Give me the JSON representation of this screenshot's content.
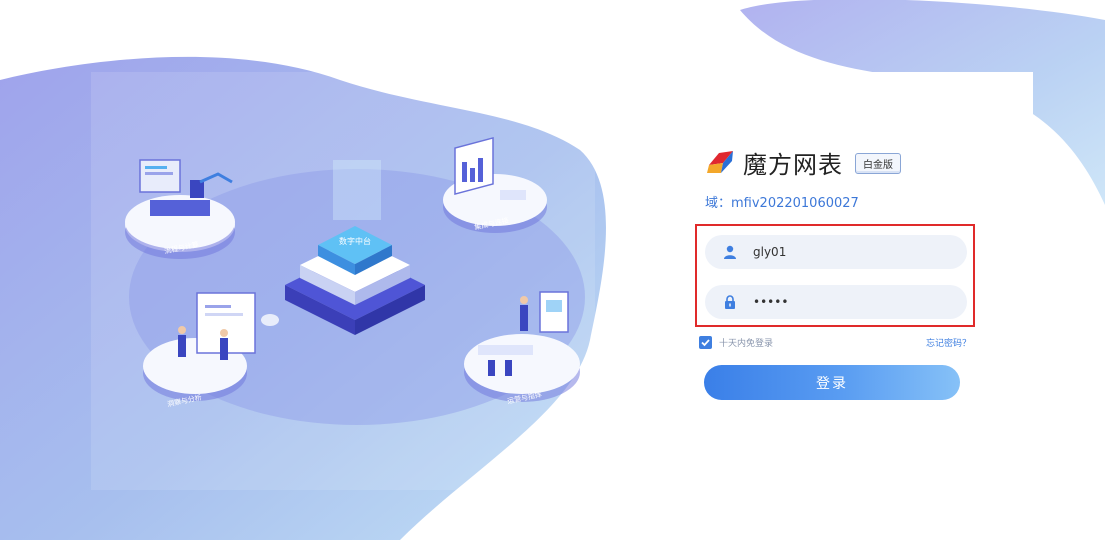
{
  "brand": {
    "name": "魔方网表",
    "edition": "白金版"
  },
  "domain": {
    "text": "域：mfiv202201060027"
  },
  "login_form": {
    "username_value": "gly01",
    "password_value": "•••••",
    "remember_label": "十天内免登录",
    "remember_checked": true,
    "forgot_label": "忘记密码？",
    "submit_label": "登录"
  },
  "illustration": {
    "center_label": "数字中台",
    "platforms": [
      {
        "label": "流程与计算"
      },
      {
        "label": "集成与连接"
      },
      {
        "label": "洞察与分析"
      },
      {
        "label": "运营与指挥"
      }
    ]
  },
  "colors": {
    "accent": "#3f7fe0",
    "highlight_border": "#e02a2a",
    "field_bg": "#eef2f9",
    "blob_purple": "#9fa8ec",
    "blob_blue": "#bcd9f4"
  }
}
